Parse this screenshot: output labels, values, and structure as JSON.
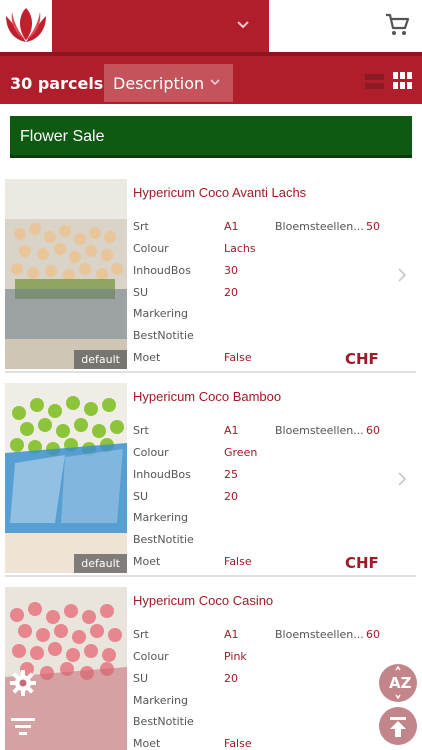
{
  "header": {
    "logo_icon": "tulip-logo-icon",
    "dropdown_icon": "chevron-down-icon",
    "cart_icon": "cart-icon"
  },
  "toolbar": {
    "count": "30 parcels",
    "sort_label": "Description",
    "list_view_icon": "list-view-icon",
    "grid_view_icon": "grid-view-icon"
  },
  "banner": {
    "text": "Flower Sale"
  },
  "colors": {
    "brand_red": "#b01e2b",
    "banner_green": "#0f5a12",
    "value_red": "#a11a28"
  },
  "products": [
    {
      "title": "Hypericum Coco Avanti Lachs",
      "image_tag": "default",
      "srt_label": "Srt",
      "srt": "A1",
      "stems_label": "Bloemsteellen...",
      "stems": "50",
      "colour_label": "Colour",
      "colour": "Lachs",
      "inhoud_label": "InhoudBos",
      "inhoud": "30",
      "su_label": "SU",
      "su": "20",
      "markering_label": "Markering",
      "bestnotitie_label": "BestNotitie",
      "moet_label": "Moet",
      "moet": "False",
      "currency": "CHF"
    },
    {
      "title": "Hypericum Coco Bamboo",
      "image_tag": "default",
      "srt_label": "Srt",
      "srt": "A1",
      "stems_label": "Bloemsteellen...",
      "stems": "60",
      "colour_label": "Colour",
      "colour": "Green",
      "inhoud_label": "InhoudBos",
      "inhoud": "25",
      "su_label": "SU",
      "su": "20",
      "markering_label": "Markering",
      "bestnotitie_label": "BestNotitie",
      "moet_label": "Moet",
      "moet": "False",
      "currency": "CHF"
    },
    {
      "title": "Hypericum Coco Casino",
      "srt_label": "Srt",
      "srt": "A1",
      "stems_label": "Bloemsteellen...",
      "stems": "60",
      "colour_label": "Colour",
      "colour": "Pink",
      "su_label": "SU",
      "su": "20",
      "markering_label": "Markering",
      "bestnotitie_label": "BestNotitie",
      "moet_label": "Moet",
      "moet": "False"
    }
  ],
  "fabs": {
    "sort_az_icon": "sort-az-icon",
    "scroll_top_icon": "scroll-to-top-icon",
    "settings_icon": "gear-icon",
    "filter_icon": "filter-icon"
  }
}
